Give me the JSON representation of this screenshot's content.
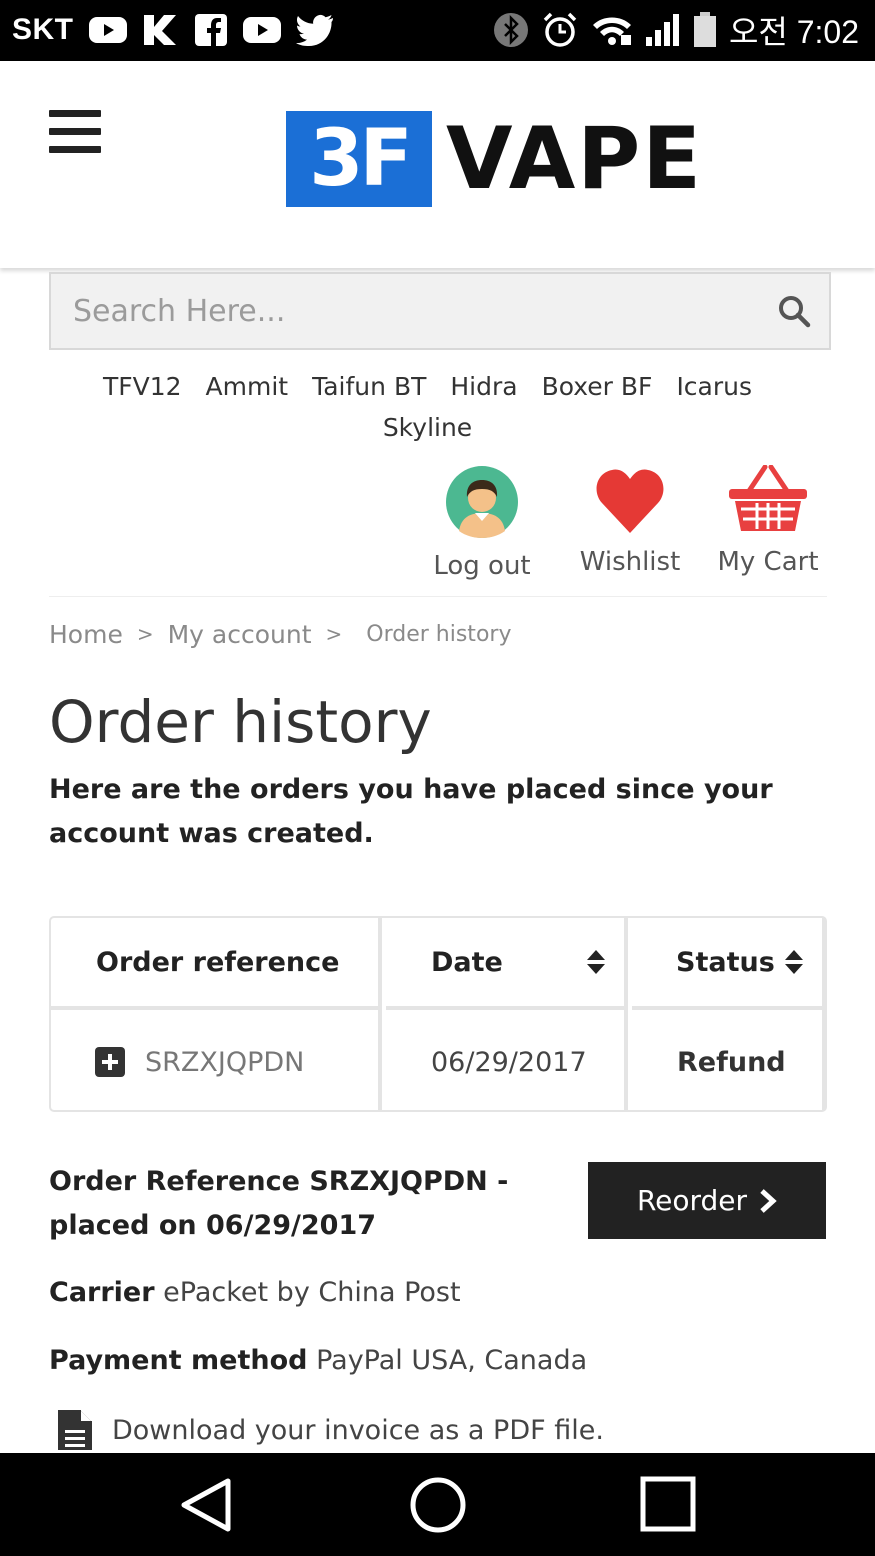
{
  "status_bar": {
    "carrier": "SKT",
    "time": "오전 7:02"
  },
  "header": {
    "logo_mark": "3F",
    "logo_text": "VAPE"
  },
  "search": {
    "placeholder": "Search Here..."
  },
  "brand_nav": {
    "items": [
      "TFV12",
      "Ammit",
      "Taifun BT",
      "Hidra",
      "Boxer BF",
      "Icarus",
      "Skyline"
    ]
  },
  "account_links": {
    "logout": "Log out",
    "wishlist": "Wishlist",
    "cart": "My Cart"
  },
  "breadcrumb": {
    "home": "Home",
    "my_account": "My account",
    "current": "Order history",
    "separator": ">"
  },
  "page": {
    "title": "Order history",
    "intro": "Here are the orders you have placed since your account was created."
  },
  "orders_table": {
    "headers": {
      "reference": "Order reference",
      "date": "Date",
      "status": "Status"
    },
    "rows": [
      {
        "reference": "SRZXJQPDN",
        "date": "06/29/2017",
        "status": "Refund"
      }
    ]
  },
  "order_detail": {
    "heading": "Order Reference SRZXJQPDN - placed on 06/29/2017",
    "reorder_label": "Reorder",
    "carrier_label": "Carrier",
    "carrier_value": "ePacket by China Post",
    "payment_label": "Payment method",
    "payment_value": "PayPal USA, Canada",
    "invoice_text": "Download your invoice as a PDF file."
  },
  "colors": {
    "brand_blue": "#1b6fd6",
    "button_dark": "#222222",
    "wishlist_red": "#e53935",
    "cart_red": "#e84040"
  }
}
